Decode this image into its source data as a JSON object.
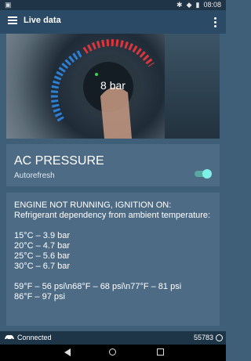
{
  "status_bar": {
    "time": "08:08"
  },
  "app_bar": {
    "title": "Live data"
  },
  "hero": {
    "value": "8 bar"
  },
  "parameter": {
    "title": "AC PRESSURE",
    "autorefresh_label": "Autorefresh",
    "autorefresh_on": true
  },
  "info": {
    "lines": [
      "ENGINE NOT RUNNING, IGNITION ON:",
      "Refrigerant dependency from ambient temperature:",
      "",
      "15°C  – 3.9 bar",
      "20°C  – 4.7 bar",
      "25°C  – 5.6 bar",
      "30°C  – 6.7 bar",
      "",
      "59°F  – 56 psi\\n68°F  – 68 psi\\n77°F  – 81 psi",
      "86°F  – 97 psi"
    ]
  },
  "bottom_bar": {
    "status": "Connected",
    "counter": "55783"
  },
  "colors": {
    "app_bar": "#2b4a66",
    "background": "#3f5f79",
    "card": "#4e6b85",
    "accent": "#7ff0e6"
  }
}
